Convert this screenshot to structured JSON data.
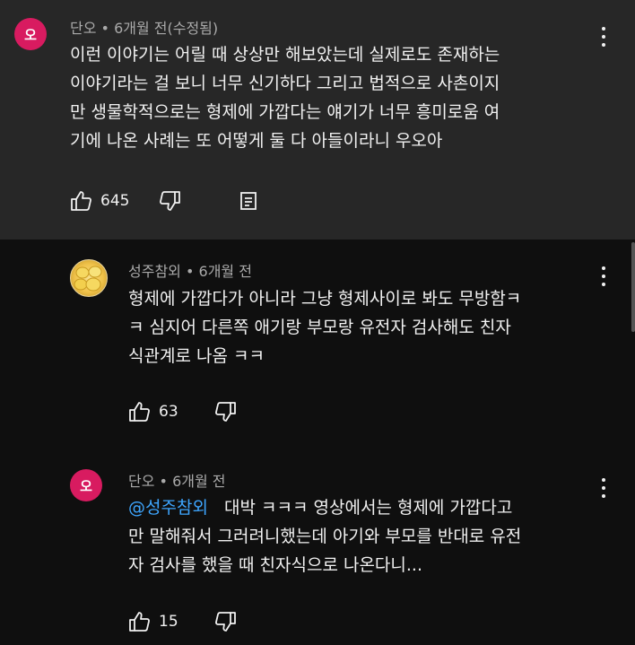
{
  "comments": [
    {
      "author": "단오",
      "meta": "• 6개월 전(수정됨)",
      "avatar_letter": "오",
      "avatar_color": "#d81b60",
      "lines": [
        "이런 이야기는 어릴 때 상상만 해보았는데 실제로도 존재하는",
        "이야기라는 걸 보니 너무 신기하다 그리고 법적으로 사촌이지",
        "만 생물학적으로는 형제에 가깝다는 얘기가 너무 흥미로움 여",
        "기에 나온 사례는 또 어떻게 둘 다 아들이라니 우오아"
      ],
      "likes": "645"
    },
    {
      "author": "성주참외",
      "meta": "• 6개월 전",
      "avatar_letter": "",
      "lines": [
        "형제에 가깝다가 아니라 그냥 형제사이로 봐도 무방함ㅋ",
        "ㅋ 심지어 다른쪽 애기랑 부모랑 유전자 검사해도 친자",
        "식관계로 나옴 ㅋㅋ"
      ],
      "likes": "63"
    },
    {
      "author": "단오",
      "meta": "• 6개월 전",
      "avatar_letter": "오",
      "avatar_color": "#d81b60",
      "mention": "@성주참외",
      "lines": [
        "대박 ㅋㅋㅋ 영상에서는 형제에 가깝다고",
        "만 말해줘서 그러려니했는데 아기와 부모를 반대로 유전",
        "자 검사를 했을 때 친자식으로 나온다니..."
      ],
      "likes": "15"
    }
  ],
  "icons": {
    "like": "thumbs-up-icon",
    "dislike": "thumbs-down-icon",
    "reply": "reply-icon",
    "menu": "more-vert-icon"
  },
  "colors": {
    "background": "#0f0f0f",
    "highlight": "#272727",
    "text": "#f1f1f1",
    "meta": "#aaaaaa",
    "mention": "#3ea6ff"
  }
}
